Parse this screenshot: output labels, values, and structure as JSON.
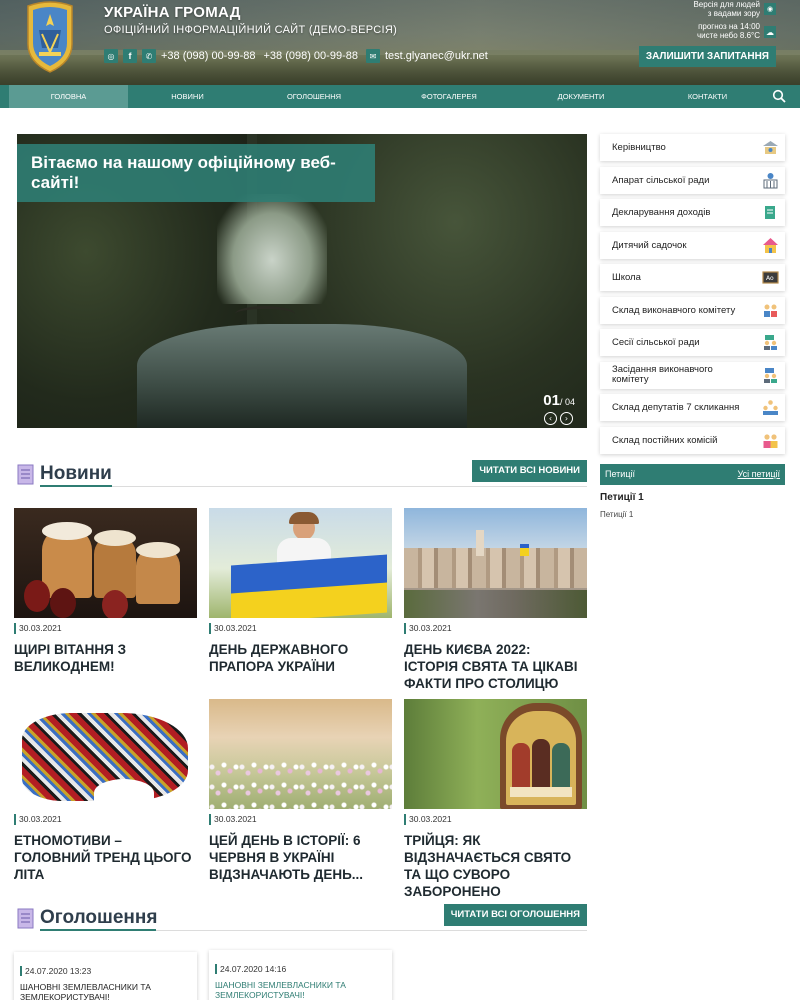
{
  "header": {
    "title": "УКРАЇНА ГРОМАД",
    "subtitle": "ОФІЦІЙНИЙ ІНФОРМАЦІЙНИЙ САЙТ (ДЕМО-ВЕРСІЯ)",
    "phone1": "+38 (098) 00-99-88",
    "phone2": "+38 (098) 00-99-88",
    "email": "test.glyanec@ukr.net",
    "vision_line1": "Версія для людей",
    "vision_line2": "з вадами зору",
    "weather_line1": "прогноз на 14:00",
    "weather_line2": "чисте небо 8.6°C",
    "request_button": "ЗАЛИШИТИ ЗАПИТАННЯ",
    "icons": [
      "instagram-icon",
      "facebook-icon",
      "phone-icon",
      "email-icon",
      "eye-icon",
      "cloud-icon"
    ]
  },
  "nav": {
    "items": [
      "ГОЛОВНА",
      "НОВИНИ",
      "ОГОЛОШЕННЯ",
      "ФОТОГАЛЕРЕЯ",
      "ДОКУМЕНТИ",
      "КОНТАКТИ"
    ],
    "active": "ГОЛОВНА"
  },
  "slider": {
    "caption": "Вітаємо на нашому офіційному веб-сайті!",
    "current": "01",
    "total": "/ 04"
  },
  "sidebar": {
    "items": [
      "Керівництво",
      "Апарат сільської ради",
      "Декларування доходів",
      "Дитячий садочок",
      "Школа",
      "Склад виконавчого комітету",
      "Сесії сільської ради",
      "Засідання виконавчого комітету",
      "Склад депутатів 7 скликання",
      "Склад постійних комісій"
    ],
    "petitions_label": "Петиції",
    "petitions_all": "Усі петиції",
    "petition_title": "Петиції 1",
    "petition_sub": "Петиції 1"
  },
  "news": {
    "title": "Новини",
    "button": "ЧИТАТИ ВСІ НОВИНИ",
    "items": [
      {
        "date": "30.03.2021",
        "title": "ЩИРІ ВІТАННЯ З ВЕЛИКОДНЕМ!"
      },
      {
        "date": "30.03.2021",
        "title": "ДЕНЬ ДЕРЖАВНОГО ПРАПОРА УКРАЇНИ"
      },
      {
        "date": "30.03.2021",
        "title": "ДЕНЬ КИЄВА 2022: ІСТОРІЯ СВЯТА ТА ЦІКАВІ ФАКТИ ПРО СТОЛИЦЮ"
      },
      {
        "date": "30.03.2021",
        "title": "ЕТНОМОТИВИ – ГОЛОВНИЙ ТРЕНД ЦЬОГО ЛІТА"
      },
      {
        "date": "30.03.2021",
        "title": "ЦЕЙ ДЕНЬ В ІСТОРІЇ: 6 ЧЕРВНЯ В УКРАЇНІ ВІДЗНАЧАЮТЬ ДЕНЬ..."
      },
      {
        "date": "30.03.2021",
        "title": "ТРІЙЦЯ: ЯК ВІДЗНАЧАЄТЬСЯ СВЯТО ТА ЩО СУВОРО ЗАБОРОНЕНО"
      }
    ]
  },
  "announcements": {
    "title": "Оголошення",
    "button": "ЧИТАТИ ВСІ ОГОЛОШЕННЯ",
    "items": [
      {
        "date": "24.07.2020 13:23",
        "title": "ШАНОВНІ ЗЕМЛЕВЛАСНИКИ ТА ЗЕМЛЕКОРИСТУВАЧІ!"
      },
      {
        "date": "24.07.2020 14:16",
        "title": "ШАНОВНІ ЗЕМЛЕВЛАСНИКИ ТА ЗЕМЛЕКОРИСТУВАЧІ!"
      }
    ]
  },
  "colors": {
    "accent": "#2f7d73",
    "nav_active": "#5b9b93",
    "heading": "#2f3e4c"
  }
}
